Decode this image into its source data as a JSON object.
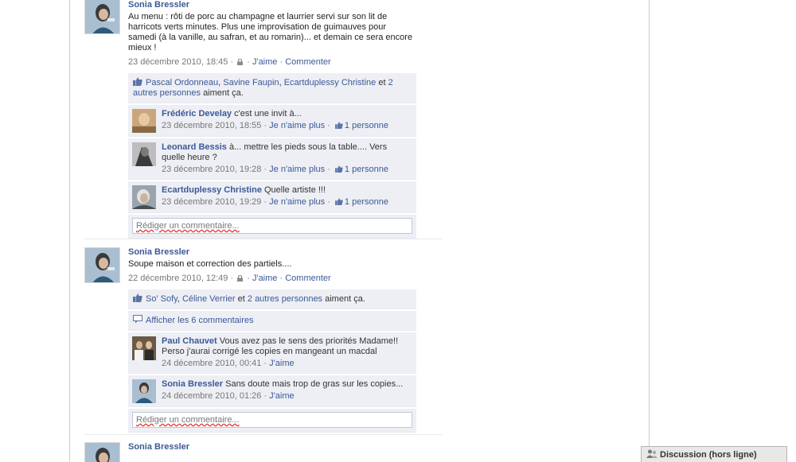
{
  "posts": [
    {
      "author": "Sonia Bressler",
      "text": "Au menu : rôti de porc au champagne et laurrier servi sur son lit de harricots verts minutes. Plus une improvisation de guimauves pour samedi (à la vanille, au safran, et au romarin)... et demain ce sera encore mieux !",
      "date": "23 décembre 2010, 18:45",
      "like": "J'aime",
      "comment": "Commenter",
      "likers": [
        "Pascal Ordonneau",
        "Savine Faupin",
        "Ecartduplessy Christine"
      ],
      "likes_and": "et",
      "likes_others": "2 autres personnes",
      "likes_suffix": "aiment ça.",
      "comments": [
        {
          "name": "Frédéric Develay",
          "text": "c'est une invit à...",
          "date": "23 décembre 2010, 18:55",
          "unlike": "Je n'aime plus",
          "count": "1 personne"
        },
        {
          "name": "Leonard Bessis",
          "text": "à... mettre les pieds sous la table.... Vers quelle heure ?",
          "date": "23 décembre 2010, 19:28",
          "unlike": "Je n'aime plus",
          "count": "1 personne"
        },
        {
          "name": "Ecartduplessy Christine",
          "text": "Quelle artiste !!!",
          "date": "23 décembre 2010, 19:29",
          "unlike": "Je n'aime plus",
          "count": "1 personne"
        }
      ],
      "input_placeholder": "Rédiger un commentaire..."
    },
    {
      "author": "Sonia Bressler",
      "text": "Soupe maison et correction des partiels....",
      "date": "22 décembre 2010, 12:49",
      "like": "J'aime",
      "comment": "Commenter",
      "likers": [
        "So' Sofy",
        "Céline Verrier"
      ],
      "likes_and": "et",
      "likes_others": "2 autres personnes",
      "likes_suffix": "aiment ça.",
      "show_comments": "Afficher les 6 commentaires",
      "comments": [
        {
          "name": "Paul Chauvet",
          "text": "Vous avez pas le sens des priorités Madame!! Perso j'aurai corrigé les copies en mangeant un macdal",
          "date": "24 décembre 2010, 00:41",
          "like": "J'aime"
        },
        {
          "name": "Sonia Bressler",
          "text": "Sans doute mais trop de gras sur les copies...",
          "date": "24 décembre 2010, 01:26",
          "like": "J'aime"
        }
      ],
      "input_placeholder": "Rédiger un commentaire..."
    },
    {
      "author": "Sonia Bressler"
    }
  ],
  "chat": {
    "label": "Discussion (hors ligne)"
  },
  "colors": {
    "link": "#3b5998",
    "ufi_bg": "#edeff4",
    "meta": "#777777"
  }
}
